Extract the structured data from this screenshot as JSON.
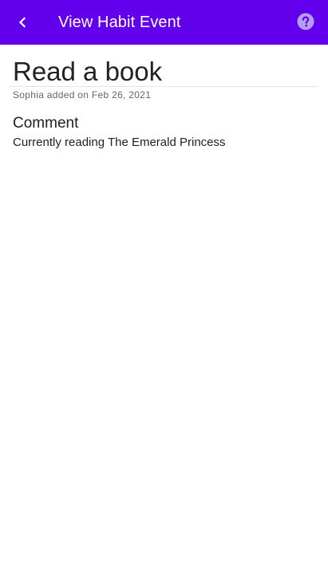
{
  "app_bar": {
    "title": "View Habit Event",
    "back_icon": "chevron-left-icon",
    "help_icon": "help-circle-icon",
    "background_color": "#6200ee",
    "help_icon_color": "#b59df0"
  },
  "event": {
    "title": "Read a book",
    "added_by_line": "Sophia added on Feb 26, 2021",
    "comment_label": "Comment",
    "comment_text": "Currently reading The Emerald Princess"
  }
}
